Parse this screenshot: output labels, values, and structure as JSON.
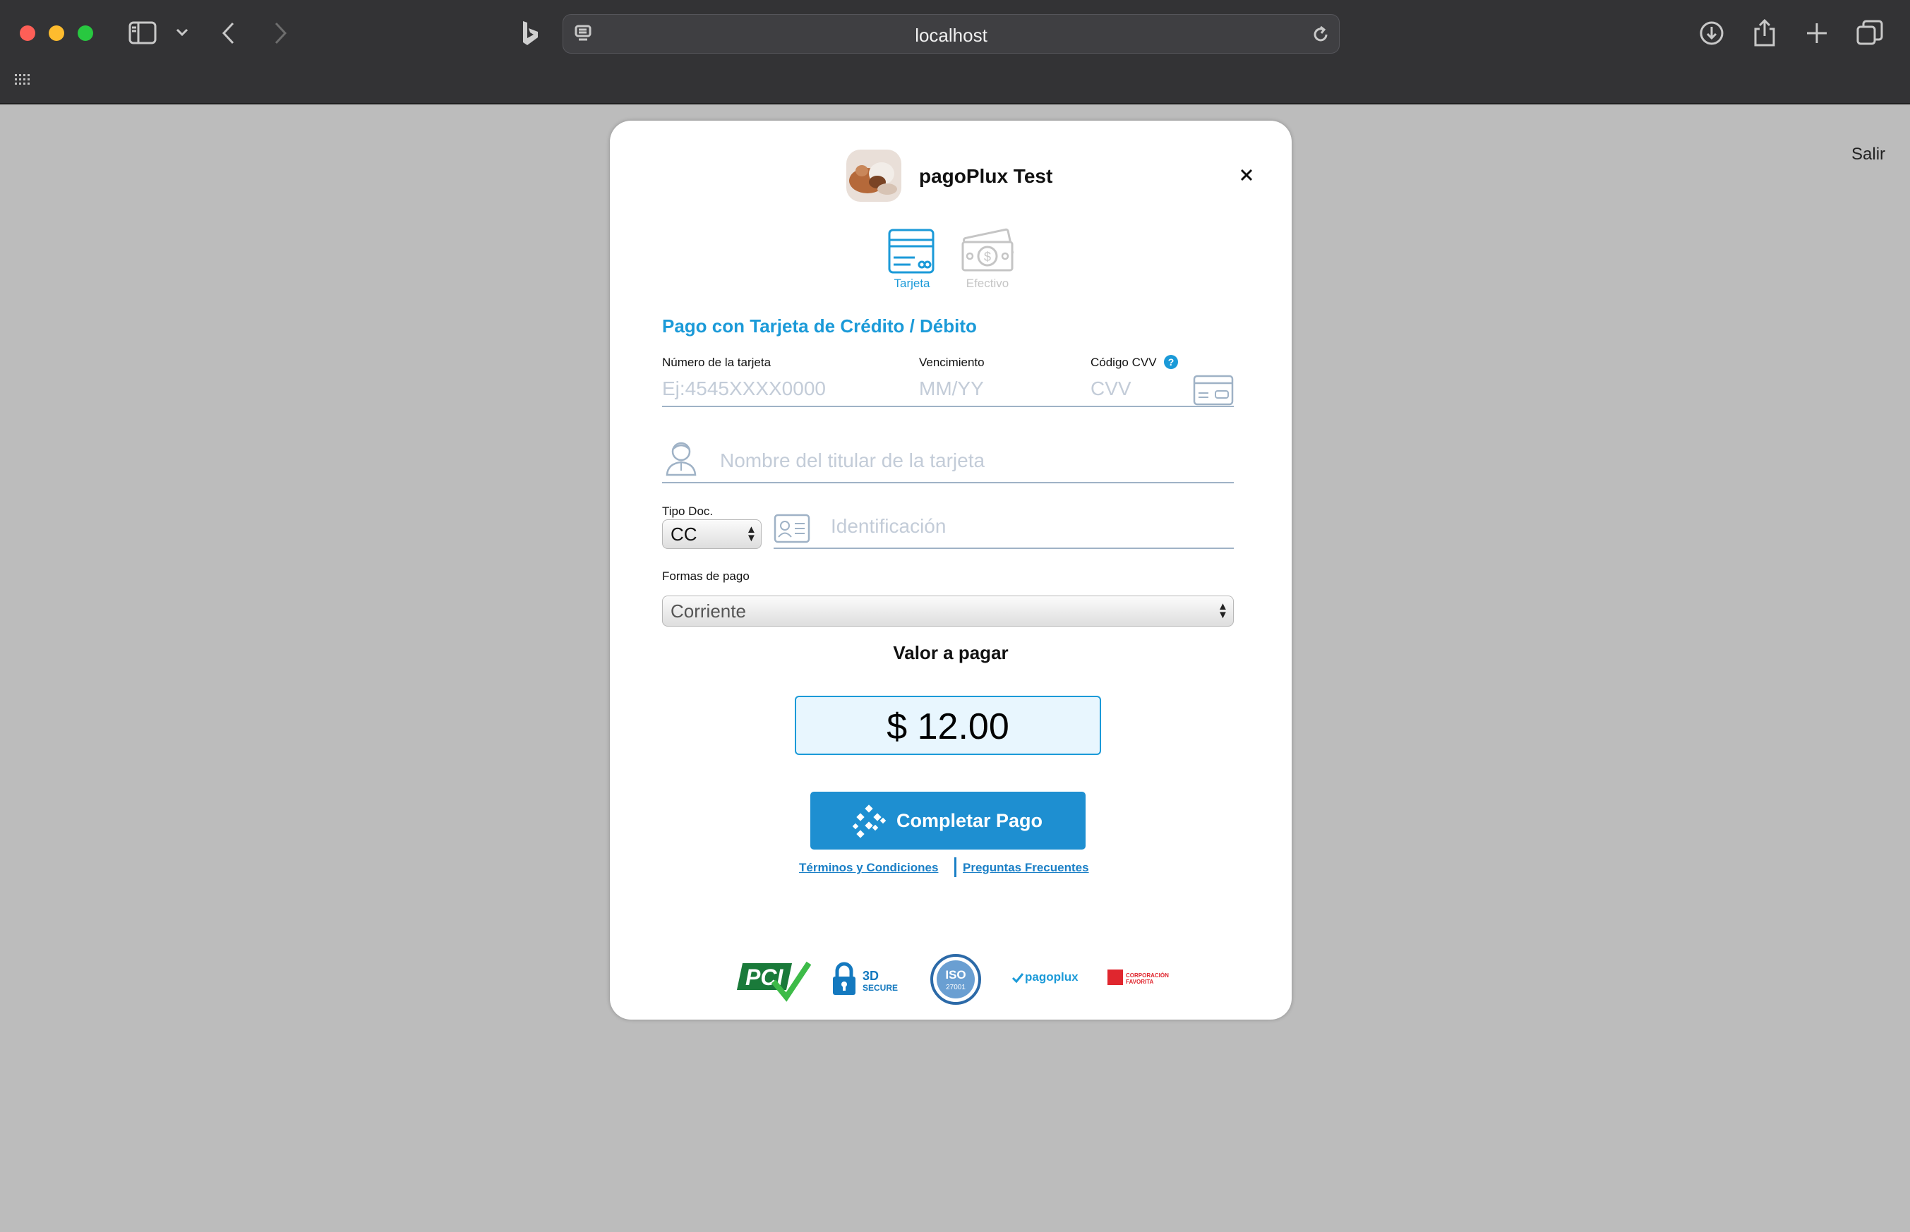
{
  "browser": {
    "url": "localhost"
  },
  "page": {
    "exit_link": "Salir"
  },
  "modal": {
    "merchant_name": "pagoPlux Test",
    "tabs": [
      {
        "label": "Tarjeta",
        "active": true
      },
      {
        "label": "Efectivo",
        "active": false
      }
    ],
    "section_title": "Pago con Tarjeta de Crédito / Débito",
    "card_number": {
      "label": "Número de la tarjeta",
      "placeholder": "Ej:4545XXXX0000"
    },
    "expiry": {
      "label": "Vencimiento",
      "placeholder": "MM/YY"
    },
    "cvv": {
      "label": "Código CVV",
      "help": "?",
      "placeholder": "CVV"
    },
    "holder": {
      "placeholder": "Nombre del titular de la tarjeta"
    },
    "doc_type": {
      "label": "Tipo Doc.",
      "value": "CC"
    },
    "identification": {
      "placeholder": "Identificación"
    },
    "payment_method": {
      "label": "Formas de pago",
      "value": "Corriente"
    },
    "amount": {
      "label": "Valor a pagar",
      "value": "$ 12.00"
    },
    "submit_label": "Completar Pago",
    "terms_link": "Términos y Condiciones",
    "faq_link": "Preguntas Frecuentes",
    "badges": {
      "pci": "PCI",
      "secure_top": "3D",
      "secure_bottom": "SECURE",
      "iso": "ISO",
      "iso_number": "27001",
      "pagoplux": "pagoplux",
      "favorita": "CORPORACIÓN FAVORITA"
    }
  },
  "colors": {
    "accent": "#1b9ad8",
    "button": "#1e8fd1"
  }
}
